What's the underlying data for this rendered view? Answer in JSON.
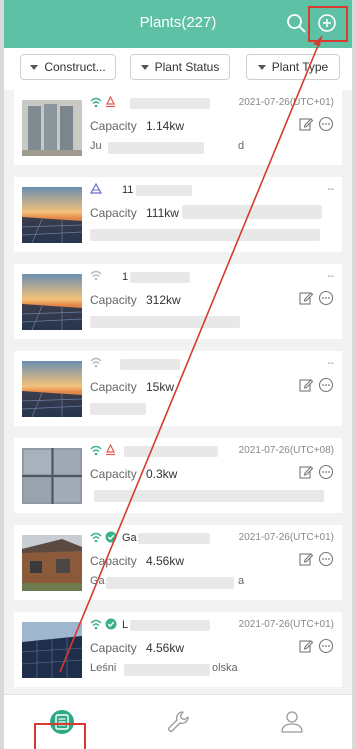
{
  "header": {
    "title": "Plants(227)",
    "search_icon": "search-icon",
    "add_icon": "add-circle-icon"
  },
  "filters": [
    {
      "label": "Construct..."
    },
    {
      "label": "Plant Status"
    },
    {
      "label": "Plant Type"
    }
  ],
  "plants": [
    {
      "name": "",
      "date": "2021-07-26(UTC+01)",
      "capacity_label": "Capacity",
      "capacity": "1.14kw",
      "location_start": "Ju",
      "location_end": "d",
      "thumb": "gray-panels"
    },
    {
      "name": "11",
      "date": "--",
      "capacity_label": "Capacity",
      "capacity": "111kw",
      "location_start": "",
      "location_end": "",
      "thumb": "solar-sunset"
    },
    {
      "name": "1",
      "date": "--",
      "capacity_label": "Capacity",
      "capacity": "312kw",
      "location_start": "",
      "location_end": "",
      "thumb": "solar-sunset"
    },
    {
      "name": "",
      "date": "--",
      "capacity_label": "Capacity",
      "capacity": "15kw",
      "location_start": "",
      "location_end": "",
      "thumb": "solar-sunset"
    },
    {
      "name": "",
      "date": "2021-07-26(UTC+08)",
      "capacity_label": "Capacity",
      "capacity": "0.3kw",
      "location_start": "",
      "location_end": "",
      "thumb": "window-grid"
    },
    {
      "name": "Ga",
      "date": "2021-07-26(UTC+01)",
      "capacity_label": "Capacity",
      "capacity": "4.56kw",
      "location_start": "Ga",
      "location_end": "a",
      "thumb": "house-roof"
    },
    {
      "name": "L",
      "date": "2021-07-26(UTC+01)",
      "capacity_label": "Capacity",
      "capacity": "4.56kw",
      "location_start": "Leśni",
      "location_end": "olska",
      "thumb": "dark-panels"
    }
  ],
  "tabbar": {
    "tabs": [
      {
        "name": "plants-list-icon",
        "active": true
      },
      {
        "name": "wrench-icon",
        "active": false
      },
      {
        "name": "user-icon",
        "active": false
      }
    ]
  },
  "colors": {
    "brand": "#5ec1a5",
    "highlight": "#d73a2f"
  }
}
